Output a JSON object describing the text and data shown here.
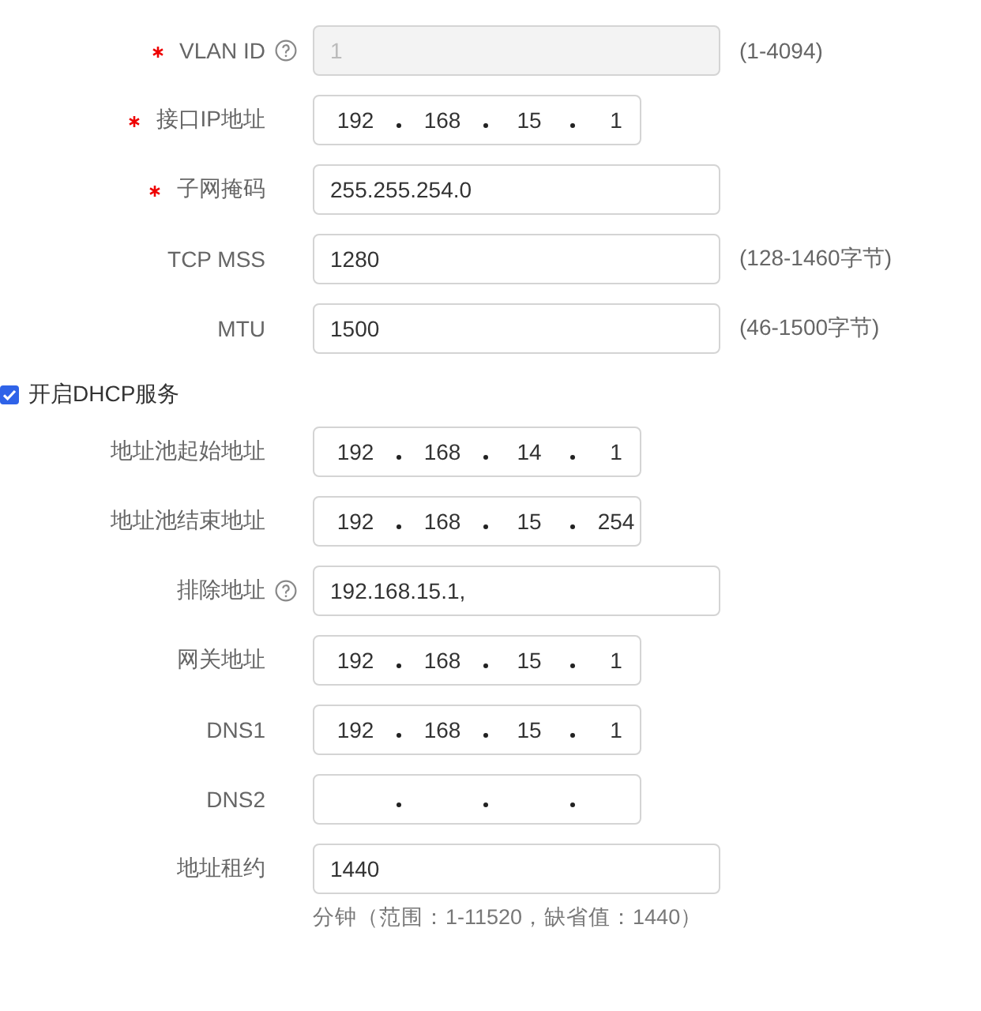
{
  "interface_fields": [
    {
      "kind": "text",
      "label": "VLAN ID",
      "required": true,
      "help": true,
      "disabled": true,
      "value": "1",
      "hint": "(1-4094)"
    },
    {
      "kind": "ip",
      "label": "接口IP地址",
      "required": true,
      "help": false,
      "disabled": false,
      "octets": [
        "192",
        "168",
        "15",
        "1"
      ]
    },
    {
      "kind": "text",
      "label": "子网掩码",
      "required": true,
      "help": false,
      "disabled": false,
      "value": "255.255.254.0"
    },
    {
      "kind": "text",
      "label": "TCP MSS",
      "required": false,
      "help": false,
      "disabled": false,
      "value": "1280",
      "hint": "(128-1460字节)"
    },
    {
      "kind": "text",
      "label": "MTU",
      "required": false,
      "help": false,
      "disabled": false,
      "value": "1500",
      "hint": "(46-1500字节)"
    }
  ],
  "dhcp": {
    "label": "开启DHCP服务",
    "checked": true,
    "fields": [
      {
        "kind": "ip",
        "label": "地址池起始地址",
        "required": false,
        "help": false,
        "disabled": false,
        "octets": [
          "192",
          "168",
          "14",
          "1"
        ]
      },
      {
        "kind": "ip",
        "label": "地址池结束地址",
        "required": false,
        "help": false,
        "disabled": false,
        "octets": [
          "192",
          "168",
          "15",
          "254"
        ]
      },
      {
        "kind": "text",
        "label": "排除地址",
        "required": false,
        "help": true,
        "disabled": false,
        "value": "192.168.15.1,"
      },
      {
        "kind": "ip",
        "label": "网关地址",
        "required": false,
        "help": false,
        "disabled": false,
        "octets": [
          "192",
          "168",
          "15",
          "1"
        ]
      },
      {
        "kind": "ip",
        "label": "DNS1",
        "required": false,
        "help": false,
        "disabled": false,
        "octets": [
          "192",
          "168",
          "15",
          "1"
        ]
      },
      {
        "kind": "ip",
        "label": "DNS2",
        "required": false,
        "help": false,
        "disabled": false
      },
      {
        "kind": "text",
        "label": "地址租约",
        "required": false,
        "help": false,
        "disabled": false,
        "value": "1440",
        "note": "分钟（范围：1-11520，缺省值：1440）"
      }
    ]
  }
}
